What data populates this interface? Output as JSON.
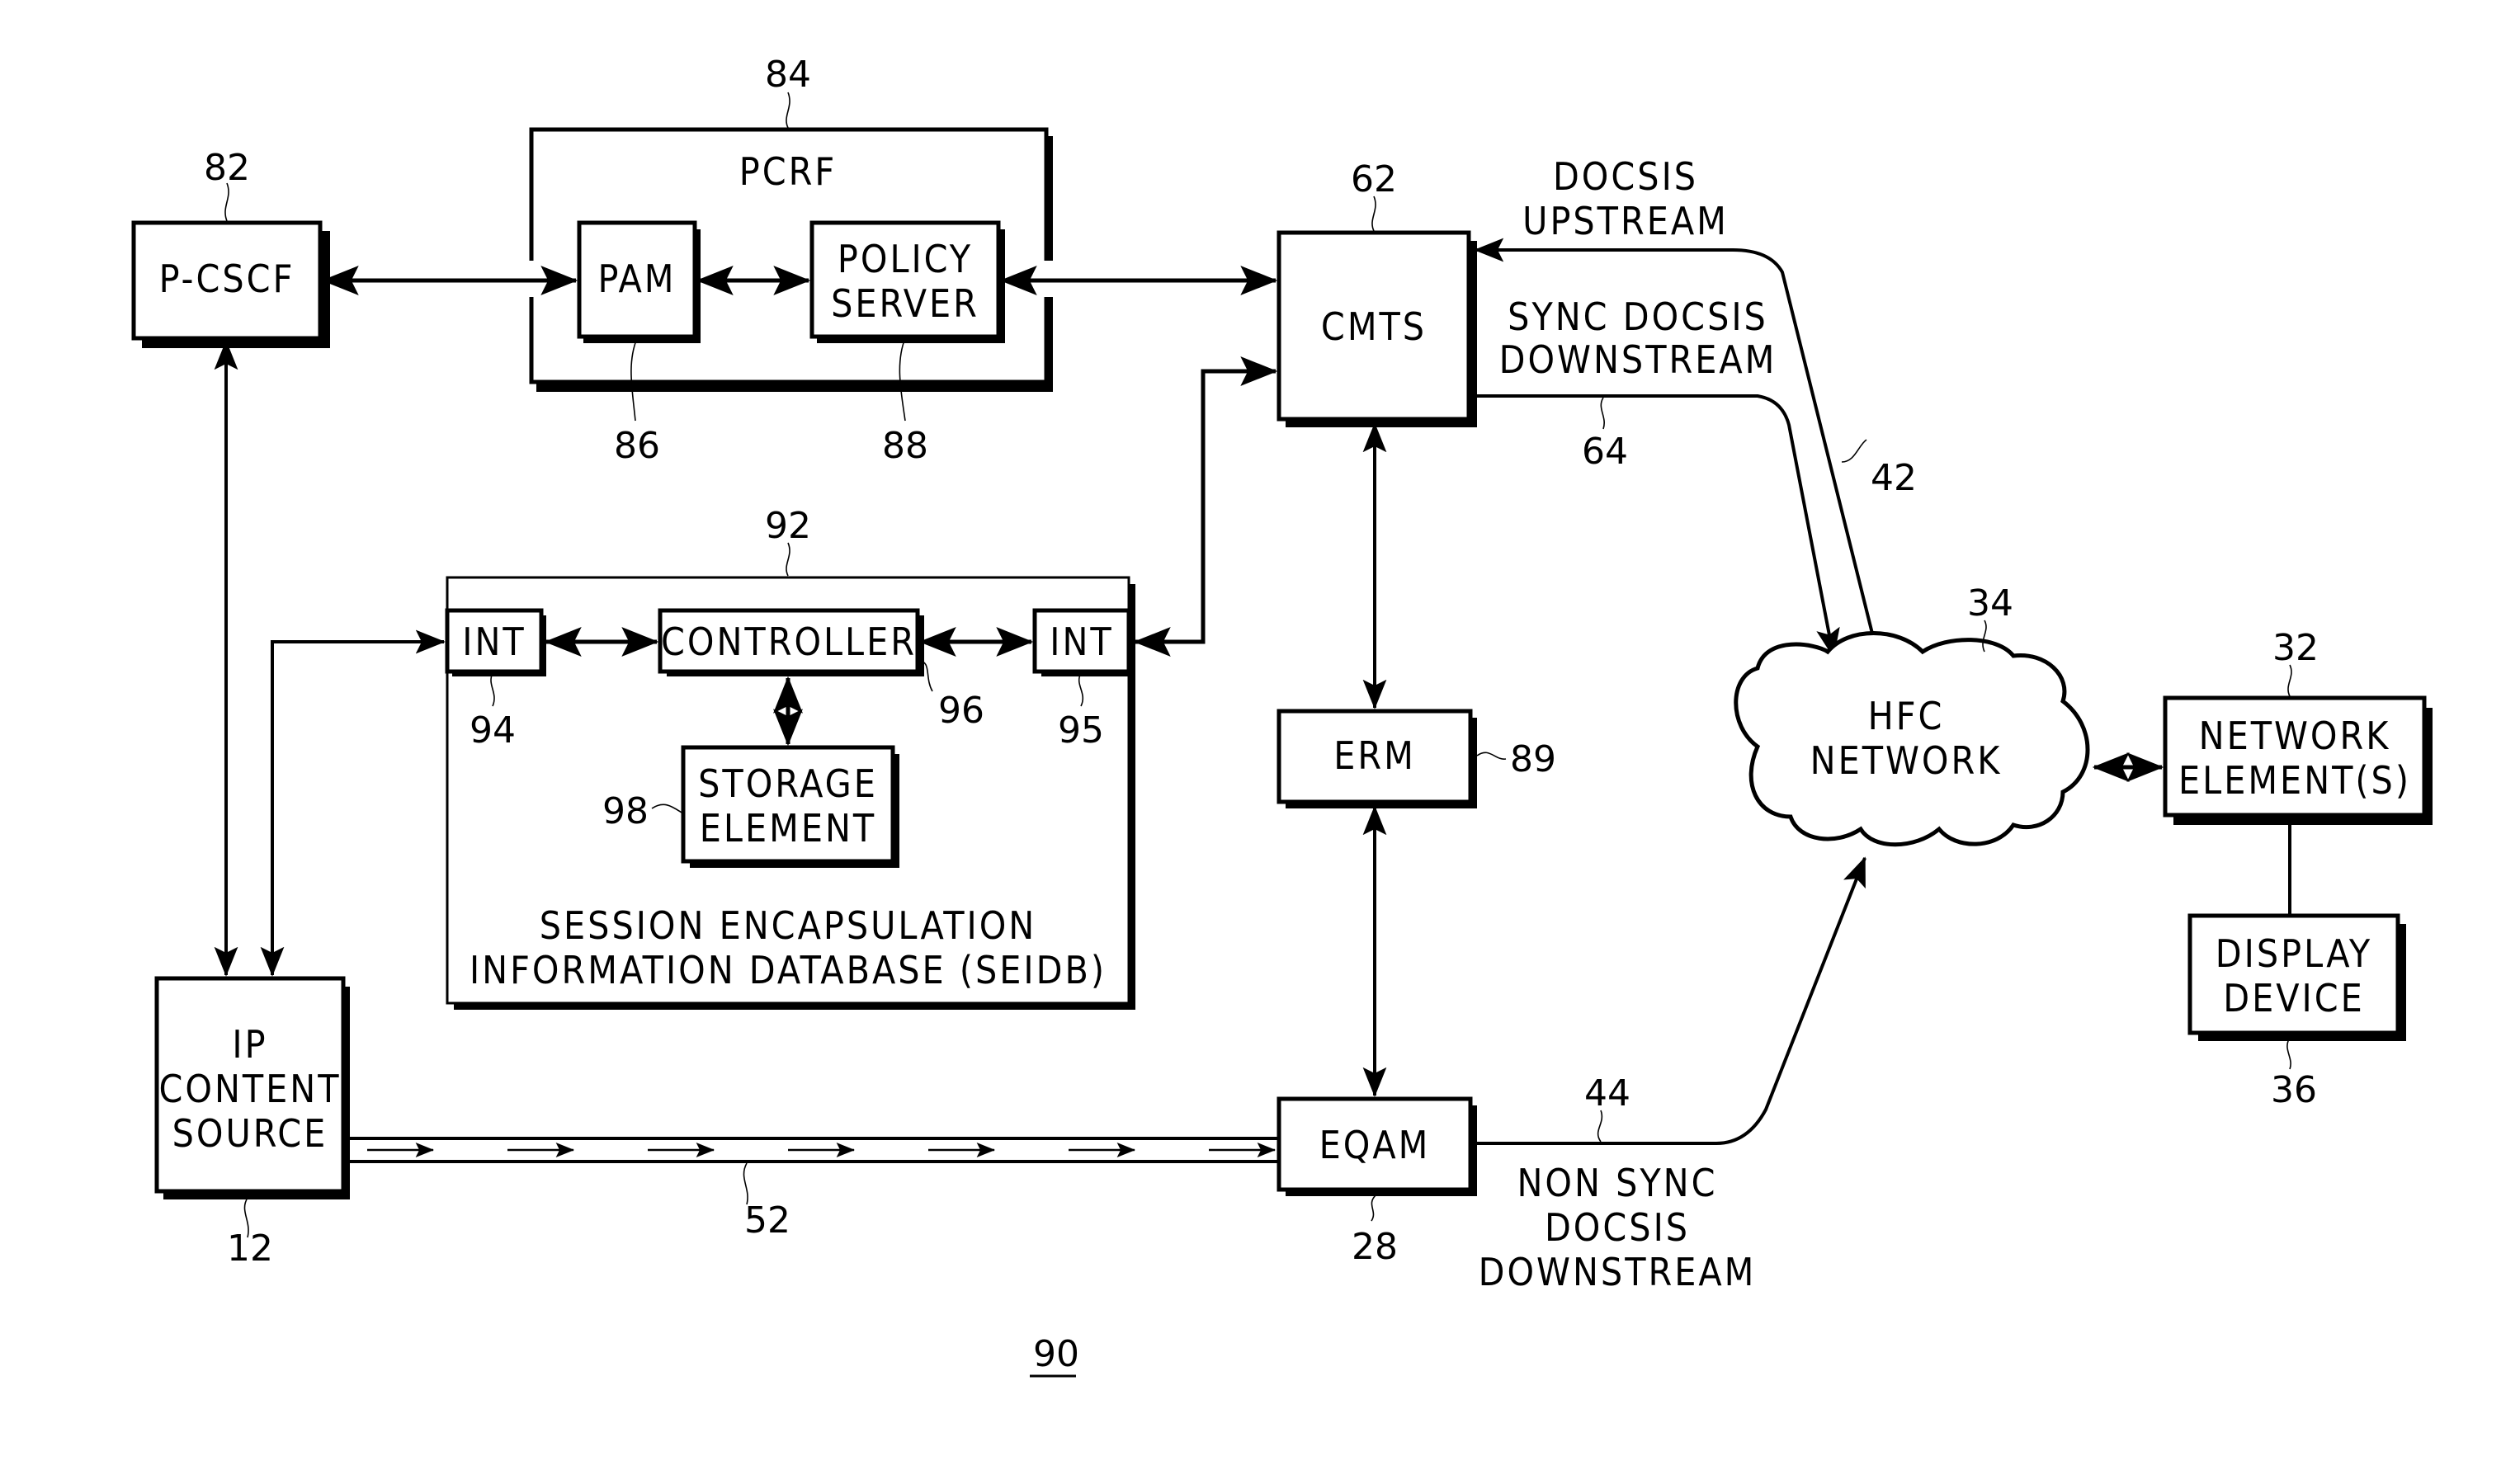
{
  "figure": {
    "number": "90"
  },
  "blocks": {
    "pcscf": {
      "label": "P-CSCF",
      "ref": "82"
    },
    "pcrf": {
      "label": "PCRF",
      "ref": "84"
    },
    "pam": {
      "label": "PAM",
      "ref": "86"
    },
    "policy_server": {
      "lines": [
        "POLICY",
        "SERVER"
      ],
      "ref": "88"
    },
    "cmts": {
      "label": "CMTS",
      "ref": "62"
    },
    "seidb": {
      "lines": [
        "SESSION ENCAPSULATION",
        "INFORMATION DATABASE (SEIDB)"
      ],
      "ref": "92"
    },
    "int_left": {
      "label": "INT",
      "ref": "94"
    },
    "controller": {
      "label": "CONTROLLER",
      "ref": "96"
    },
    "int_right": {
      "label": "INT",
      "ref": "95"
    },
    "storage": {
      "lines": [
        "STORAGE",
        "ELEMENT"
      ],
      "ref": "98"
    },
    "erm": {
      "label": "ERM",
      "ref": "89"
    },
    "eqam": {
      "label": "EQAM",
      "ref": "28"
    },
    "ip_source": {
      "lines": [
        "IP",
        "CONTENT",
        "SOURCE"
      ],
      "ref": "12"
    },
    "hfc": {
      "lines": [
        "HFC",
        "NETWORK"
      ],
      "ref": "34"
    },
    "network_elements": {
      "lines": [
        "NETWORK",
        "ELEMENT(S)"
      ],
      "ref": "32"
    },
    "display": {
      "lines": [
        "DISPLAY",
        "DEVICE"
      ],
      "ref": "36"
    }
  },
  "links": {
    "docsis_upstream": {
      "lines": [
        "DOCSIS",
        "UPSTREAM"
      ],
      "ref": "42"
    },
    "sync_downstream": {
      "lines": [
        "SYNC DOCSIS",
        "DOWNSTREAM"
      ],
      "ref": "64"
    },
    "nonsync_downstream": {
      "lines": [
        "NON SYNC",
        "DOCSIS",
        "DOWNSTREAM"
      ],
      "ref": "44"
    },
    "ip_stream": {
      "ref": "52"
    }
  }
}
